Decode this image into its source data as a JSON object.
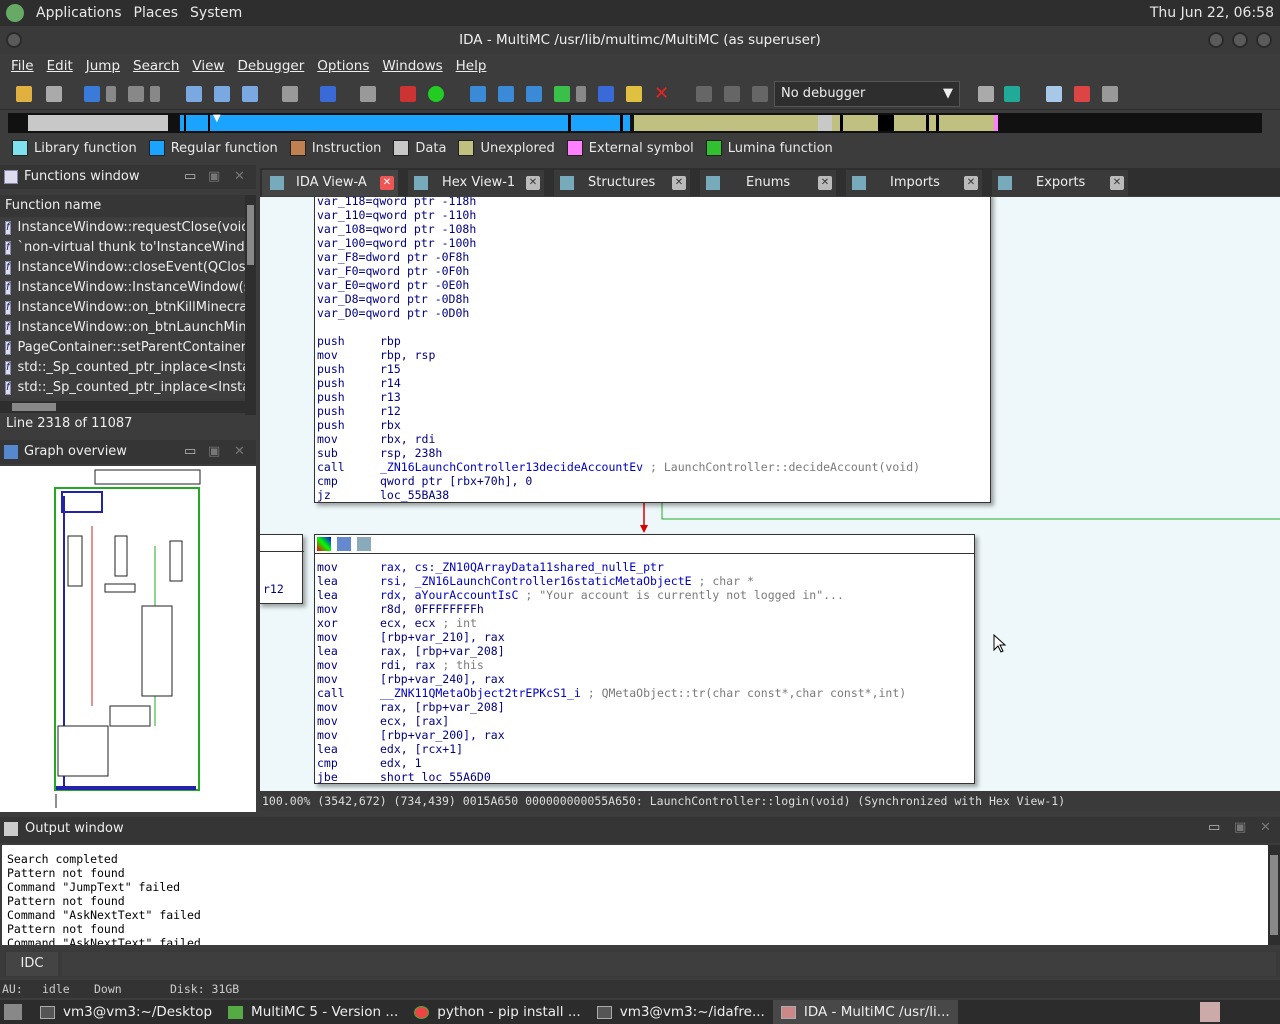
{
  "topbar": {
    "menus": [
      "Applications",
      "Places",
      "System"
    ],
    "clock": "Thu Jun 22, 06:58"
  },
  "window": {
    "title": "IDA - MultiMC /usr/lib/multimc/MultiMC (as superuser)"
  },
  "menubar": [
    "File",
    "Edit",
    "Jump",
    "Search",
    "View",
    "Debugger",
    "Options",
    "Windows",
    "Help"
  ],
  "toolbar": {
    "debugger_select": "No debugger"
  },
  "legend": [
    {
      "label": "Library function",
      "color": "#7fe0f0"
    },
    {
      "label": "Regular function",
      "color": "#1aa3ff"
    },
    {
      "label": "Instruction",
      "color": "#c08050"
    },
    {
      "label": "Data",
      "color": "#c8c8c8"
    },
    {
      "label": "Unexplored",
      "color": "#c0c080"
    },
    {
      "label": "External symbol",
      "color": "#ff80ff"
    },
    {
      "label": "Lumina function",
      "color": "#30c030"
    }
  ],
  "functions": {
    "title": "Functions window",
    "column": "Function name",
    "items": [
      "InstanceWindow::requestClose(void)",
      "`non-virtual thunk to'InstanceWindow",
      "InstanceWindow::closeEvent(QCloseE",
      "InstanceWindow::InstanceWindow(st",
      "InstanceWindow::on_btnKillMinecraf",
      "InstanceWindow::on_btnLaunchMine",
      "PageContainer::setParentContainer(B",
      "std::_Sp_counted_ptr_inplace<Instan",
      "std::_Sp_counted_ptr_inplace<Instan"
    ],
    "line_status": "Line 2318 of 11087"
  },
  "graph_overview": {
    "title": "Graph overview"
  },
  "tabs": [
    "IDA View-A",
    "Hex View-1",
    "Structures",
    "Enums",
    "Imports",
    "Exports"
  ],
  "block1": [
    {
      "a": "var_118=",
      "b": "qword ptr -118h"
    },
    {
      "a": "var_110=",
      "b": "qword ptr -110h"
    },
    {
      "a": "var_108=",
      "b": "qword ptr -108h"
    },
    {
      "a": "var_100=",
      "b": "qword ptr -100h"
    },
    {
      "a": "var_F8=",
      "b": "dword ptr -0F8h"
    },
    {
      "a": "var_F0=",
      "b": "qword ptr -0F0h"
    },
    {
      "a": "var_E0=",
      "b": "qword ptr -0E0h"
    },
    {
      "a": "var_D8=",
      "b": "qword ptr -0D8h"
    },
    {
      "a": "var_D0=",
      "b": "qword ptr -0D0h"
    },
    {
      "a": "",
      "b": ""
    },
    {
      "a": "push",
      "b": "rbp"
    },
    {
      "a": "mov",
      "b": "rbp, rsp"
    },
    {
      "a": "push",
      "b": "r15"
    },
    {
      "a": "push",
      "b": "r14"
    },
    {
      "a": "push",
      "b": "r13"
    },
    {
      "a": "push",
      "b": "r12"
    },
    {
      "a": "push",
      "b": "rbx"
    },
    {
      "a": "mov",
      "b": "rbx, rdi"
    },
    {
      "a": "sub",
      "b": "rsp, 238h"
    },
    {
      "a": "call",
      "b": "_ZN16LaunchController13decideAccountEv",
      "c": "; LaunchController::decideAccount(void)"
    },
    {
      "a": "cmp",
      "b": "qword ptr [rbx+70h], 0"
    },
    {
      "a": "jz",
      "b": "loc_55BA38"
    }
  ],
  "block2": [
    {
      "a": "mov",
      "b": "rax, cs:_ZN10QArrayData11shared_nullE_ptr"
    },
    {
      "a": "lea",
      "b": "rsi, _ZN16LaunchController16staticMetaObjectE",
      "c": "; char *"
    },
    {
      "a": "lea",
      "b": "rdx, aYourAccountIsC",
      "c": "; \"Your account is currently not logged in\"..."
    },
    {
      "a": "mov",
      "b": "r8d, 0FFFFFFFFh"
    },
    {
      "a": "xor",
      "b": "ecx, ecx",
      "c": "; int"
    },
    {
      "a": "mov",
      "b": "[rbp+var_210], rax"
    },
    {
      "a": "lea",
      "b": "rax, [rbp+var_208]"
    },
    {
      "a": "mov",
      "b": "rdi, rax",
      "c": "; this"
    },
    {
      "a": "mov",
      "b": "[rbp+var_240], rax"
    },
    {
      "a": "call",
      "b": "__ZNK11QMetaObject2trEPKcS1_i",
      "c": "; QMetaObject::tr(char const*,char const*,int)"
    },
    {
      "a": "mov",
      "b": "rax, [rbp+var_208]"
    },
    {
      "a": "mov",
      "b": "ecx, [rax]"
    },
    {
      "a": "mov",
      "b": "[rbp+var_200], rax"
    },
    {
      "a": "lea",
      "b": "edx, [rcx+1]"
    },
    {
      "a": "cmp",
      "b": "edx, 1"
    },
    {
      "a": "jbe",
      "b": "short loc_55A6D0"
    }
  ],
  "side_block_text": "r12",
  "status_line": "100.00% (3542,672) (734,439) 0015A650 000000000055A650: LaunchController::login(void) (Synchronized with Hex View-1)",
  "output": {
    "title": "Output window",
    "lines": [
      "Search completed",
      "Pattern not found",
      "Command \"JumpText\" failed",
      "Pattern not found",
      "Command \"AskNextText\" failed",
      "Pattern not found",
      "Command \"AskNextText\" failed"
    ]
  },
  "idc": "IDC",
  "au_status": {
    "au": "AU:",
    "state": "idle",
    "dir": "Down",
    "disk": "Disk: 31GB"
  },
  "taskbar": [
    "vm3@vm3:~/Desktop",
    "MultiMC 5 - Version ...",
    "python - pip install ...",
    "vm3@vm3:~/idafre...",
    "IDA - MultiMC /usr/li..."
  ]
}
